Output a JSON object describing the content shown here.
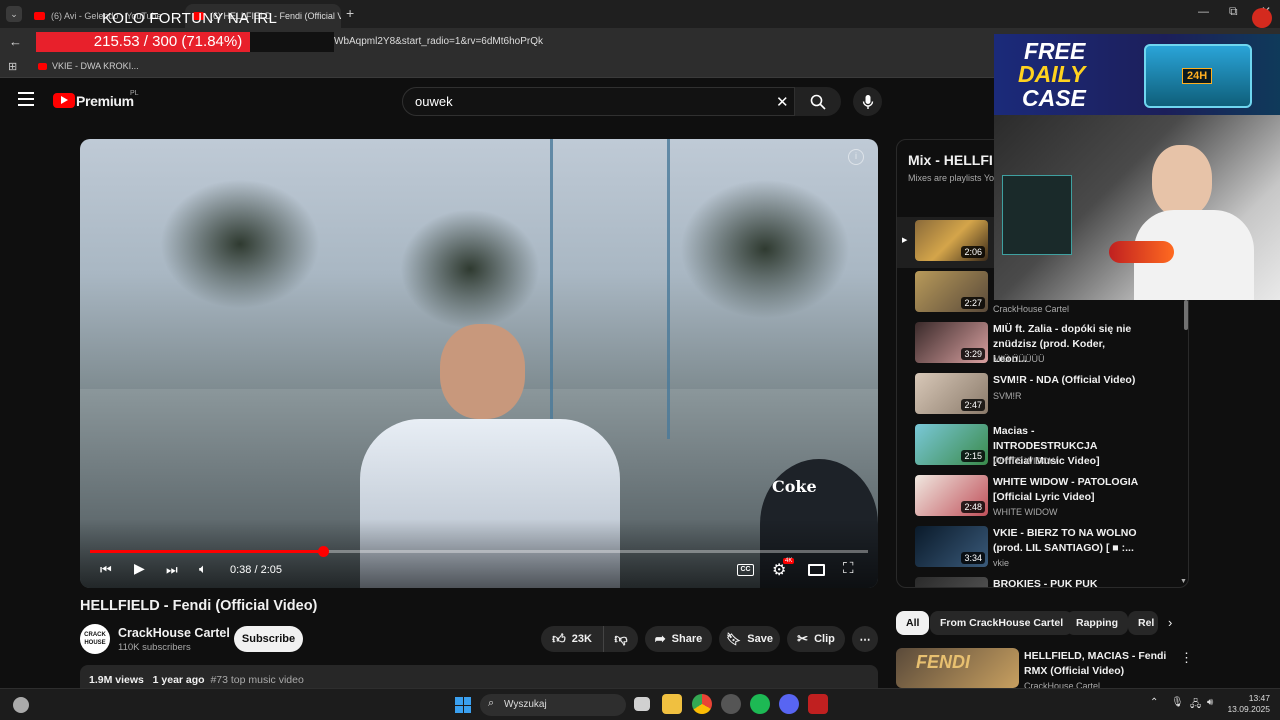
{
  "browser": {
    "tabs": [
      {
        "label": "(6) Avi - Gelendo - YouTube"
      },
      {
        "label": "(6) HELLFIELD - Fendi (Official V"
      }
    ],
    "url": "WbAqpml2Y8&start_radio=1&rv=6dMt6hoPrQk",
    "bookmark": "VKIE - DWA KROKI..."
  },
  "overlay": {
    "title": "KOLO FORTUNY NA IRL",
    "progress_text": "215.53 / 300 (71.84%)",
    "progress": 0.7184
  },
  "header": {
    "logo": "Premium",
    "region": "PL",
    "search_value": "ouwek"
  },
  "player": {
    "time": "0:38 / 2:05",
    "progress": 0.3,
    "quality_badge": "4K",
    "shirt_text": "Coke"
  },
  "video": {
    "title": "HELLFIELD - Fendi (Official Video)",
    "channel": "CrackHouse Cartel",
    "subscribers": "110K subscribers",
    "subscribe": "Subscribe",
    "likes": "23K",
    "share": "Share",
    "save": "Save",
    "clip": "Clip",
    "views": "1.9M views",
    "age": "1 year ago",
    "tag": "#73 top music video"
  },
  "mix": {
    "title": "Mix - HELLFI",
    "subtitle": "Mixes are playlists You",
    "items": [
      {
        "duration": "2:06",
        "title": "",
        "channel": ""
      },
      {
        "duration": "2:27",
        "title": "",
        "channel": "CrackHouse Cartel"
      },
      {
        "duration": "3:29",
        "title": "MIÜ ft. Zalia - dopóki się nie znüdzisz (prod. Koder, Leon...",
        "channel": "MIÜ ÜÜÜÜÜ"
      },
      {
        "duration": "2:47",
        "title": "SVM!R - NDA (Official Video)",
        "channel": "SVM!R"
      },
      {
        "duration": "2:15",
        "title": "Macias - INTRODESTRUKCJA [Official Music Video]",
        "channel": "WHITE WIDOW"
      },
      {
        "duration": "2:48",
        "title": "WHITE WIDOW - PATOLOGIA [Official Lyric Video]",
        "channel": "WHITE WIDOW"
      },
      {
        "duration": "3:34",
        "title": "VKIE - BIERZ TO NA WOLNO (prod. LIL SANTIAGO) [ ■ :...",
        "channel": "vkie"
      },
      {
        "duration": "",
        "title": "BROKIES - PUK PUK",
        "channel": ""
      }
    ]
  },
  "chips": [
    "All",
    "From CrackHouse Cartel",
    "Rapping",
    "Rel"
  ],
  "related": {
    "title": "HELLFIELD, MACIAS - Fendi RMX (Official Video)",
    "channel": "CrackHouse Cartel",
    "thumb_text": "FENDI"
  },
  "promo": {
    "line1": "FREE",
    "line2": "DAILY",
    "line3": "CASE",
    "badge": "24H"
  },
  "taskbar": {
    "search": "Wyszukaj",
    "time": "13:47",
    "date": "13.09.2025"
  },
  "colors": {
    "red": "#ff0000",
    "progress_red": "#e8202b",
    "bg": "#0f0f0f"
  }
}
